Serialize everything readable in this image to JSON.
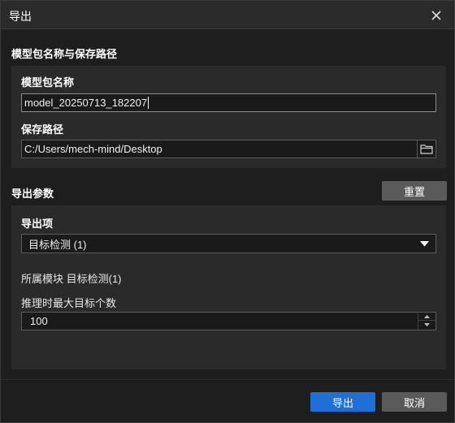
{
  "dialog": {
    "title": "导出",
    "close_icon": "close-icon"
  },
  "model_section": {
    "title": "模型包名称与保存路径",
    "name_label": "模型包名称",
    "name_value": "model_20250713_182207",
    "path_label": "保存路径",
    "path_value": "C:/Users/mech-mind/Desktop",
    "folder_icon": "folder-icon"
  },
  "export_section": {
    "title": "导出参数",
    "reset_label": "重置",
    "item_label": "导出项",
    "item_selected": "目标检测 (1)",
    "module_text": "所属模块 目标检测(1)",
    "max_targets_label": "推理时最大目标个数",
    "max_targets_value": "100"
  },
  "footer": {
    "export_label": "导出",
    "cancel_label": "取消"
  },
  "colors": {
    "background": "#1e1e1e",
    "panel": "#2a2a2a",
    "primary": "#1f6fd6",
    "grey_button": "#5a5a5a"
  }
}
